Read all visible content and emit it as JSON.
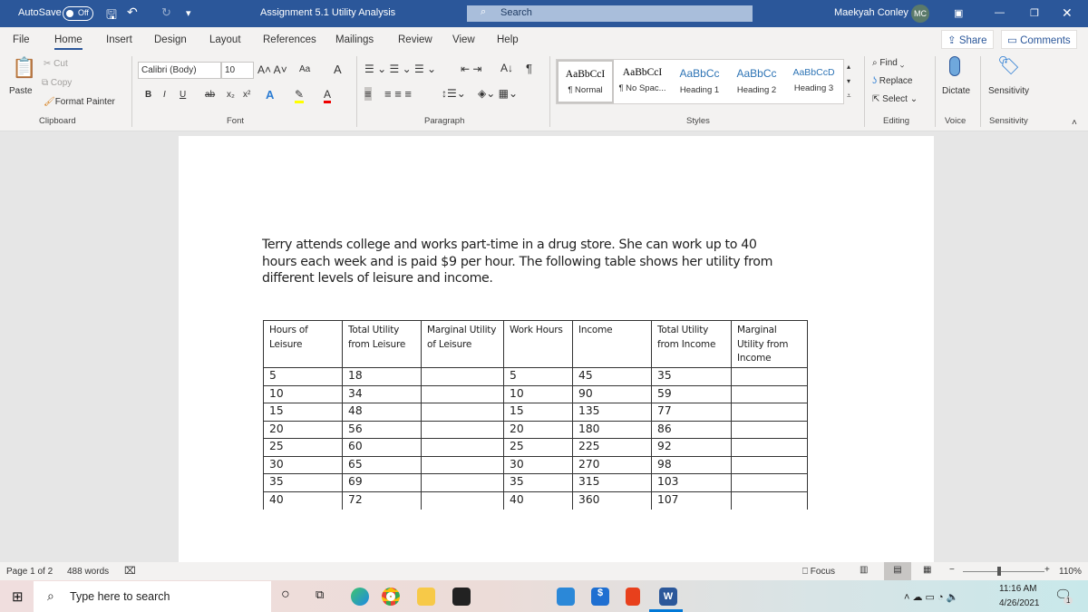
{
  "titlebar": {
    "autosave": "AutoSave",
    "autosave_state": "Off",
    "title": "Assignment 5.1 Utility Analysis",
    "search": "Search",
    "user": "Maekyah Conley",
    "initials": "MC"
  },
  "tabs": [
    "File",
    "Home",
    "Insert",
    "Design",
    "Layout",
    "References",
    "Mailings",
    "Review",
    "View",
    "Help"
  ],
  "active_tab": "Home",
  "share": "Share",
  "comments": "Comments",
  "ribbon": {
    "clipboard": {
      "paste": "Paste",
      "cut": "Cut",
      "copy": "Copy",
      "format_painter": "Format Painter",
      "label": "Clipboard"
    },
    "font": {
      "name": "Calibri (Body)",
      "size": "10",
      "label": "Font",
      "case": "Aa"
    },
    "paragraph": {
      "label": "Paragraph"
    },
    "styles": {
      "items": [
        {
          "preview": "AaBbCcI",
          "name": "¶ Normal"
        },
        {
          "preview": "AaBbCcI",
          "name": "¶ No Spac..."
        },
        {
          "preview": "AaBbCc",
          "name": "Heading 1"
        },
        {
          "preview": "AaBbCc",
          "name": "Heading 2"
        },
        {
          "preview": "AaBbCcD",
          "name": "Heading 3"
        }
      ],
      "label": "Styles"
    },
    "editing": {
      "find": "Find",
      "replace": "Replace",
      "select": "Select",
      "label": "Editing"
    },
    "voice": {
      "dictate": "Dictate",
      "label": "Voice"
    },
    "sensitivity": {
      "button": "Sensitivity",
      "label": "Sensitivity"
    }
  },
  "document": {
    "paragraph": "Terry attends college and works part-time in a drug store. She can work up to 40 hours each week and is paid $9 per hour. The following table shows her utility from different levels of leisure and income.",
    "table": {
      "headers": [
        "Hours of Leisure",
        "Total Utility from Leisure",
        "Marginal Utility of Leisure",
        "Work Hours",
        "Income",
        "Total Utility from Income",
        "Marginal Utility from Income"
      ],
      "rows": [
        [
          "5",
          "18",
          "",
          "5",
          "45",
          "35",
          ""
        ],
        [
          "10",
          "34",
          "",
          "10",
          "90",
          "59",
          ""
        ],
        [
          "15",
          "48",
          "",
          "15",
          "135",
          "77",
          ""
        ],
        [
          "20",
          "56",
          "",
          "20",
          "180",
          "86",
          ""
        ],
        [
          "25",
          "60",
          "",
          "25",
          "225",
          "92",
          ""
        ],
        [
          "30",
          "65",
          "",
          "30",
          "270",
          "98",
          ""
        ],
        [
          "35",
          "69",
          "",
          "35",
          "315",
          "103",
          ""
        ],
        [
          "40",
          "72",
          "",
          "40",
          "360",
          "107",
          ""
        ]
      ]
    }
  },
  "status": {
    "page": "Page 1 of 2",
    "words": "488 words",
    "focus": "Focus",
    "zoom": "110%",
    "zoom_level": 110
  },
  "taskbar": {
    "search_placeholder": "Type here to search",
    "time": "11:16 AM",
    "date": "4/26/2021",
    "notifications": "1"
  },
  "colors": {
    "title_bar": "#2b579a",
    "accent": "#2b579a"
  }
}
